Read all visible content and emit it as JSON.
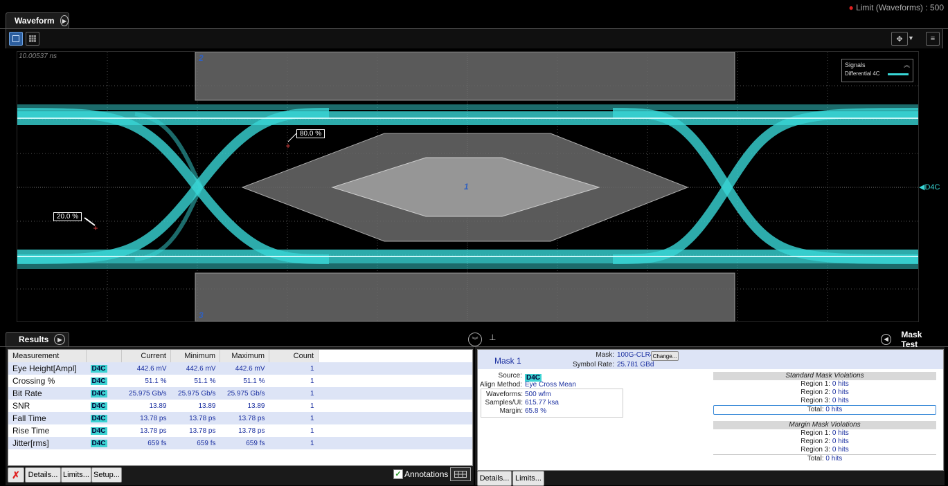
{
  "top": {
    "tab_label": "Waveform",
    "limit_text": "Limit (Waveforms) : 500"
  },
  "plot": {
    "timestamp": "10.00537 ns",
    "region_labels": [
      "2",
      "1",
      "3"
    ],
    "marker_80": "80.0 %",
    "marker_20": "20.0 %",
    "channel_marker": "D4C",
    "legend": {
      "title": "Signals",
      "item": "Differential 4C",
      "trace_color": "#38d6d6"
    }
  },
  "results": {
    "tab_label": "Results",
    "columns": [
      "Measurement",
      "Current",
      "Minimum",
      "Maximum",
      "Count"
    ],
    "rows": [
      {
        "name": "Eye Height[Ampl]",
        "src": "D4C",
        "current": "442.6 mV",
        "minimum": "442.6 mV",
        "maximum": "442.6 mV",
        "count": "1"
      },
      {
        "name": "Crossing %",
        "src": "D4C",
        "current": "51.1 %",
        "minimum": "51.1 %",
        "maximum": "51.1 %",
        "count": "1"
      },
      {
        "name": "Bit Rate",
        "src": "D4C",
        "current": "25.975 Gb/s",
        "minimum": "25.975 Gb/s",
        "maximum": "25.975 Gb/s",
        "count": "1"
      },
      {
        "name": "SNR",
        "src": "D4C",
        "current": "13.89",
        "minimum": "13.89",
        "maximum": "13.89",
        "count": "1"
      },
      {
        "name": "Fall Time",
        "src": "D4C",
        "current": "13.78 ps",
        "minimum": "13.78 ps",
        "maximum": "13.78 ps",
        "count": "1"
      },
      {
        "name": "Rise Time",
        "src": "D4C",
        "current": "13.78 ps",
        "minimum": "13.78 ps",
        "maximum": "13.78 ps",
        "count": "1"
      },
      {
        "name": "Jitter[rms]",
        "src": "D4C",
        "current": "659 fs",
        "minimum": "659 fs",
        "maximum": "659 fs",
        "count": "1"
      }
    ],
    "buttons": {
      "details": "Details...",
      "limits": "Limits...",
      "setup": "Setup...",
      "annotations": "Annotations"
    }
  },
  "mask": {
    "tab_label": "Mask Test",
    "mask_name": "Mask 1",
    "mask_label": "Mask:",
    "mask_value": "100G-CLR4",
    "change_button": "Change...",
    "symbol_rate_label": "Symbol Rate:",
    "symbol_rate_value": "25.781 GBd",
    "source_label": "Source:",
    "source_value": "D4C",
    "align_label": "Align Method:",
    "align_value": "Eye Cross Mean",
    "waveforms_label": "Waveforms:",
    "waveforms_value": "500 wfm",
    "samples_label": "Samples/UI:",
    "samples_value": "615.77 ksa",
    "margin_label": "Margin:",
    "margin_value": "65.8 %",
    "standard_title": "Standard Mask Violations",
    "margin_title": "Margin Mask Violations",
    "standard": [
      {
        "label": "Region 1:",
        "value": "0 hits"
      },
      {
        "label": "Region 2:",
        "value": "0 hits"
      },
      {
        "label": "Region 3:",
        "value": "0 hits"
      }
    ],
    "standard_total": {
      "label": "Total:",
      "value": "0 hits"
    },
    "margin": [
      {
        "label": "Region 1:",
        "value": "0 hits"
      },
      {
        "label": "Region 2:",
        "value": "0 hits"
      },
      {
        "label": "Region 3:",
        "value": "0 hits"
      }
    ],
    "margin_total": {
      "label": "Total:",
      "value": "0 hits"
    },
    "buttons": {
      "details": "Details...",
      "limits": "Limits..."
    }
  }
}
